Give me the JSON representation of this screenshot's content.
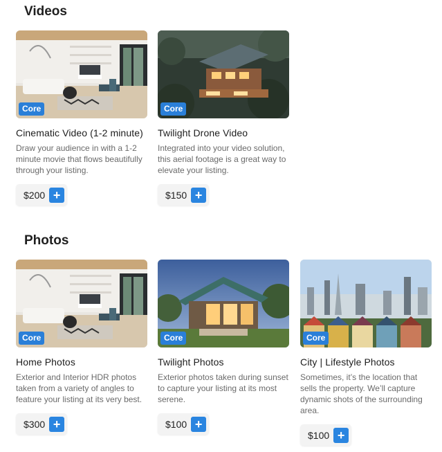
{
  "sections": {
    "videos": {
      "title": "Videos",
      "items": [
        {
          "badge": "Core",
          "title": "Cinematic Video (1-2 minute)",
          "desc": "Draw your audience in with a 1-2 minute movie that flows beautifully through your listing.",
          "price": "$200"
        },
        {
          "badge": "Core",
          "title": "Twilight Drone Video",
          "desc": "Integrated into your video solution, this aerial footage is a great way to elevate your listing.",
          "price": "$150"
        }
      ]
    },
    "photos": {
      "title": "Photos",
      "items": [
        {
          "badge": "Core",
          "title": "Home Photos",
          "desc": "Exterior and Interior HDR photos taken from a variety of angles to feature your listing at its very best.",
          "price": "$300"
        },
        {
          "badge": "Core",
          "title": "Twilight Photos",
          "desc": "Exterior photos taken during sunset to capture your listing at its most serene.",
          "price": "$100"
        },
        {
          "badge": "Core",
          "title": "City | Lifestyle Photos",
          "desc": "Sometimes, it’s the location that sells the property. We’ll capture dynamic shots of the surrounding area.",
          "price": "$100"
        }
      ]
    }
  },
  "add_label": "+",
  "colors": {
    "badge": "#2a7fd8",
    "add_button": "#2a85e0"
  }
}
